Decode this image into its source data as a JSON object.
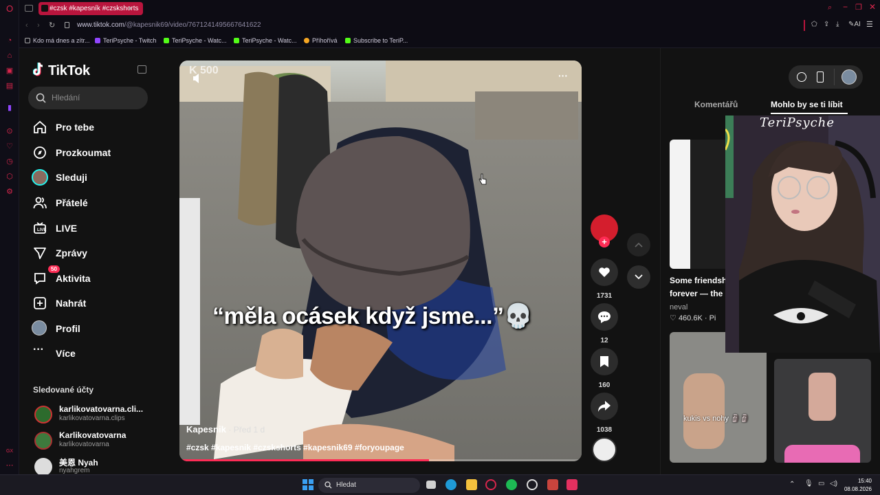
{
  "browser": {
    "tab_title": "#czsk #kapesník #czskshorts",
    "url_domain": "www.tiktok.com",
    "url_path": "/@kapesnik69/video/7671241495667641622",
    "bookmarks": [
      "Kdo má dnes a zítr...",
      "TeriPsyche - Twitch",
      "TeriPsyche - Watc...",
      "TeriPsyche - Watc...",
      "Příhořívá",
      "Subscribe to TeriP..."
    ],
    "ai_label": "AI"
  },
  "sidebar": {
    "logo": "TikTok",
    "search_placeholder": "Hledání",
    "nav": [
      {
        "label": "Pro tebe"
      },
      {
        "label": "Prozkoumat"
      },
      {
        "label": "Sleduji"
      },
      {
        "label": "Přátelé"
      },
      {
        "label": "LIVE"
      },
      {
        "label": "Zprávy"
      },
      {
        "label": "Aktivita",
        "badge": "50"
      },
      {
        "label": "Nahrát"
      },
      {
        "label": "Profil"
      },
      {
        "label": "Více"
      }
    ],
    "following_title": "Sledované účty",
    "accounts": [
      {
        "name": "karlikovatovarna.cli...",
        "handle": "karlikovatovarna.clips"
      },
      {
        "name": "Karlikovatovarna",
        "handle": "karlikovatovarna"
      },
      {
        "name": "美恩 Nyah",
        "handle": "nyahgrem"
      }
    ]
  },
  "video": {
    "caption": "“měla ocásek když jsme...”💀",
    "watermark": "K 500",
    "author": "Kapesnik",
    "posted": "· Před 1 d",
    "hashtags": "#czsk #kapesnik #czskshorts #kapesnik69 #foryoupage",
    "progress": 0.62
  },
  "actions": {
    "likes": "1731",
    "comments": "12",
    "saves": "160",
    "shares": "1038"
  },
  "right_panel": {
    "tab_comments": "Komentářů",
    "tab_suggested": "Mohlo by se ti líbit",
    "card1_title": "Some friendsh",
    "card1_title2": "forever — the",
    "card1_author": "neval",
    "card1_views": "460.6K",
    "card1_more": "Pi",
    "card2_caption": "kukis vs nohy 🗿🗿"
  },
  "webcam": {
    "overlay_title": "TeriPsyche"
  },
  "taskbar": {
    "search_label": "Hledat",
    "time": "15:40",
    "date": "08.08.2026"
  }
}
